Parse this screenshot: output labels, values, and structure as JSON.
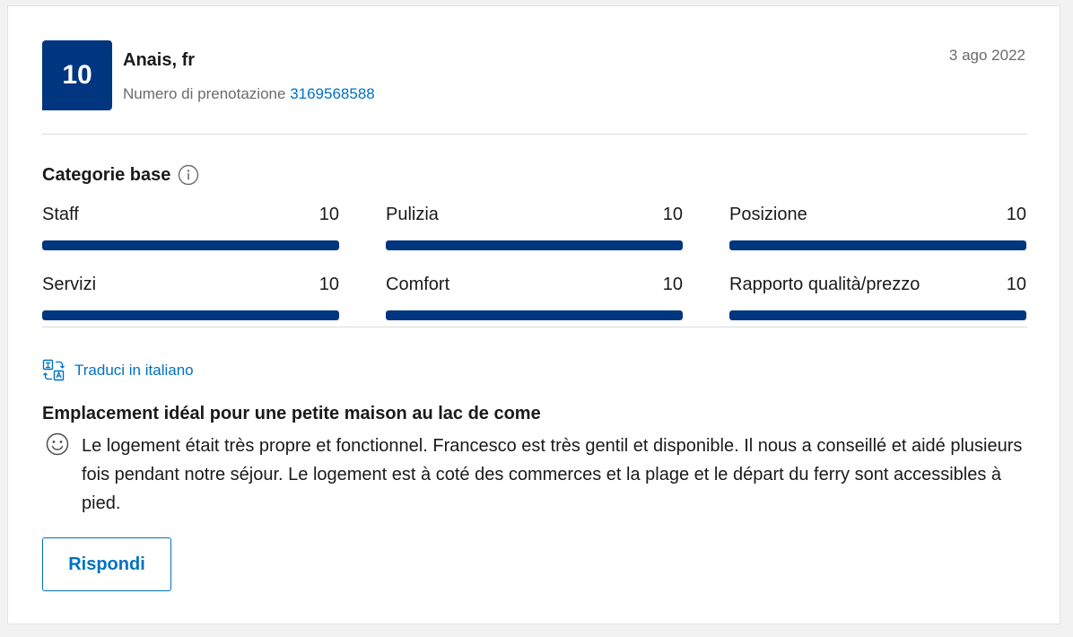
{
  "reviewer": {
    "score": "10",
    "name": "Anais, fr",
    "booking_label": "Numero di prenotazione",
    "booking_number": "3169568588",
    "date": "3 ago 2022"
  },
  "categories": {
    "heading": "Categorie base",
    "items": [
      {
        "label": "Staff",
        "value": "10",
        "fill_fraction": 1.0
      },
      {
        "label": "Pulizia",
        "value": "10",
        "fill_fraction": 1.0
      },
      {
        "label": "Posizione",
        "value": "10",
        "fill_fraction": 1.0
      },
      {
        "label": "Servizi",
        "value": "10",
        "fill_fraction": 1.0
      },
      {
        "label": "Comfort",
        "value": "10",
        "fill_fraction": 1.0
      },
      {
        "label": "Rapporto qualità/prezzo",
        "value": "10",
        "fill_fraction": 1.0
      }
    ]
  },
  "translate": {
    "label": "Traduci in italiano",
    "icon": "translate-icon"
  },
  "review": {
    "title": "Emplacement idéal pour une petite maison au lac de come",
    "sentiment_icon": "smile-icon",
    "body": "Le logement était très propre et fonctionnel. Francesco est très gentil et disponible. Il nous a conseillé et aidé plusieurs fois pendant notre séjour. Le logement est à coté des commerces et la plage et le départ du ferry sont accessibles à pied."
  },
  "actions": {
    "reply_label": "Rispondi"
  },
  "colors": {
    "brand_dark_blue": "#003580",
    "link_blue": "#0071c2",
    "muted_text": "#6b6b6b"
  }
}
